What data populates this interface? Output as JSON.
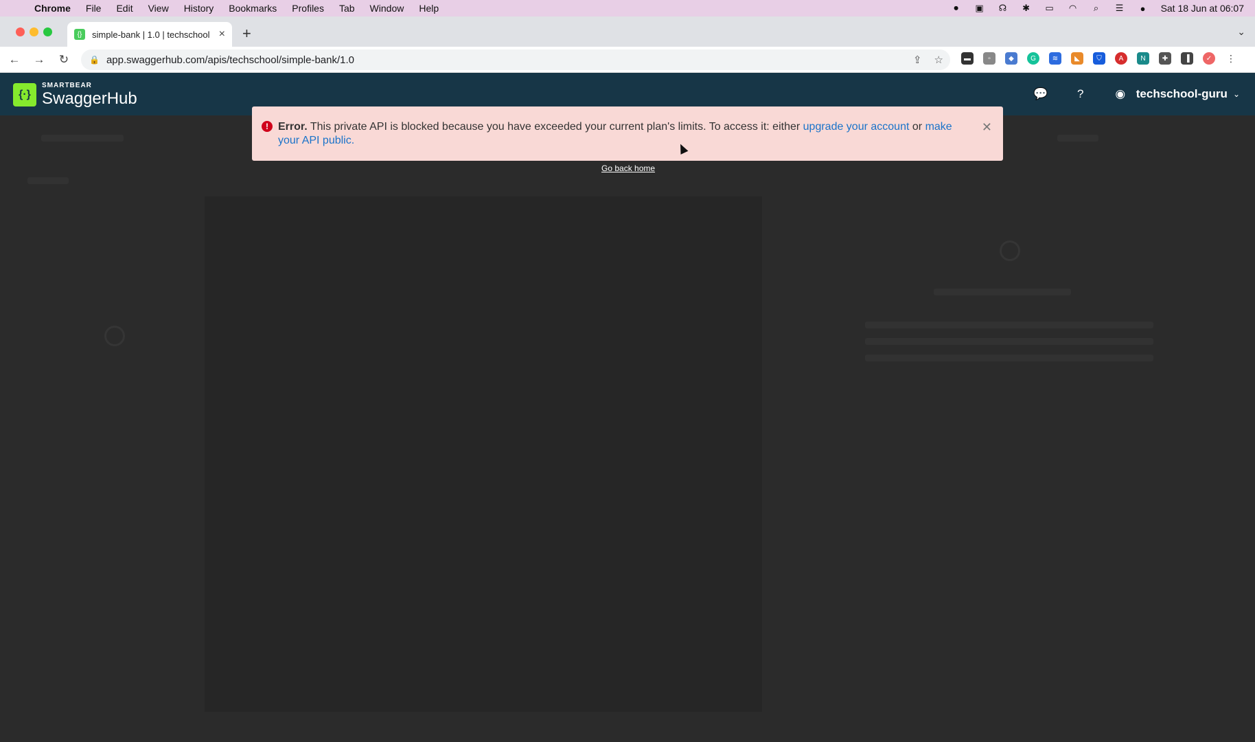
{
  "menubar": {
    "app_name": "Chrome",
    "items": [
      "File",
      "Edit",
      "View",
      "History",
      "Bookmarks",
      "Profiles",
      "Tab",
      "Window",
      "Help"
    ],
    "clock": "Sat 18 Jun at 06:07"
  },
  "browser": {
    "tab_title": "simple-bank | 1.0 | techschool",
    "url_host": "app.swaggerhub.com",
    "url_path": "/apis/techschool/simple-bank/1.0"
  },
  "header": {
    "brand_small": "SMARTBEAR",
    "brand_big": "SwaggerHub",
    "username": "techschool-guru"
  },
  "alert": {
    "title": "Error.",
    "message": "This private API is blocked because you have exceeded your current plan's limits. To access it: either",
    "link1": "upgrade your account",
    "connector": "or",
    "link2": "make your API public."
  },
  "go_back_home": "Go back home",
  "colors": {
    "header_bg": "#173647",
    "alert_bg": "#f9d9d6",
    "brand_green": "#85ea2d",
    "link": "#1a73c9"
  }
}
